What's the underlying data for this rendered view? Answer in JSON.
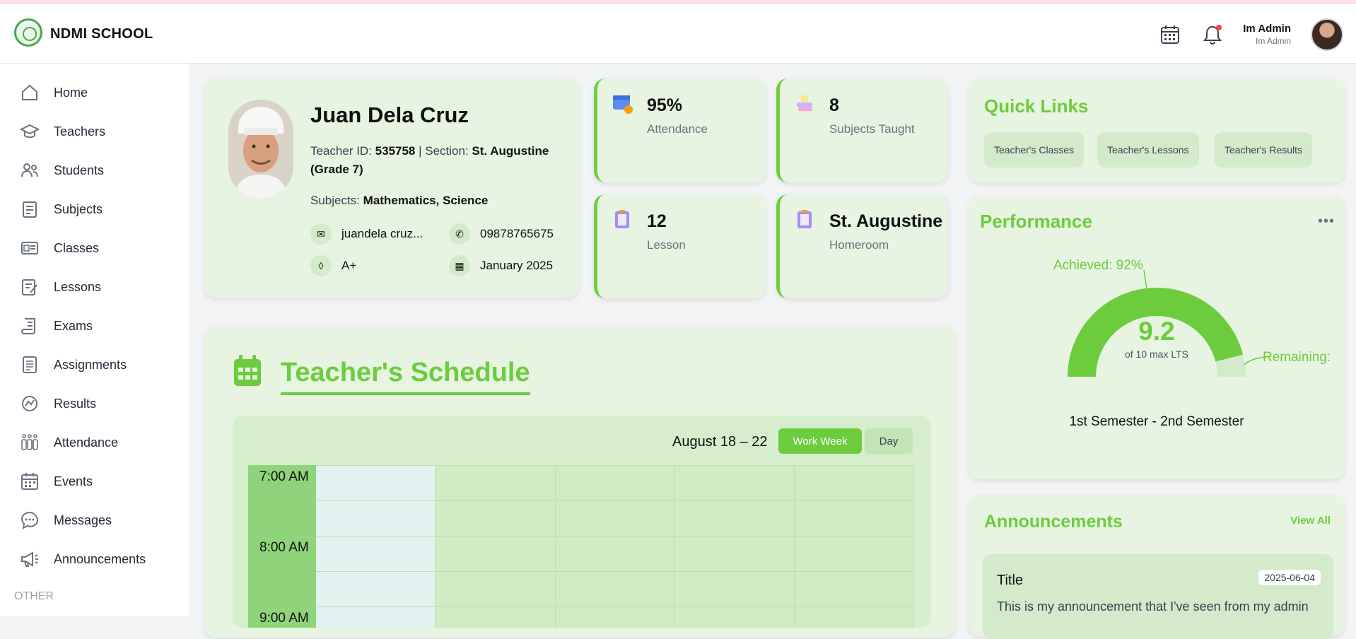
{
  "header": {
    "brand": "NDMI SCHOOL",
    "user_name": "Im Admin",
    "user_role": "Im Admin"
  },
  "sidebar": {
    "items": [
      {
        "label": "Home",
        "icon": "home-icon"
      },
      {
        "label": "Teachers",
        "icon": "graduation-cap-icon"
      },
      {
        "label": "Students",
        "icon": "users-icon"
      },
      {
        "label": "Subjects",
        "icon": "clipboard-icon"
      },
      {
        "label": "Classes",
        "icon": "id-card-icon"
      },
      {
        "label": "Lessons",
        "icon": "edit-icon"
      },
      {
        "label": "Exams",
        "icon": "scroll-icon"
      },
      {
        "label": "Assignments",
        "icon": "document-icon"
      },
      {
        "label": "Results",
        "icon": "chart-circle-icon"
      },
      {
        "label": "Attendance",
        "icon": "people-grid-icon"
      },
      {
        "label": "Events",
        "icon": "calendar-icon"
      },
      {
        "label": "Messages",
        "icon": "chat-bubble-icon"
      },
      {
        "label": "Announcements",
        "icon": "megaphone-icon"
      }
    ],
    "other_label": "OTHER"
  },
  "profile": {
    "name": "Juan Dela Cruz",
    "id_label": "Teacher ID: ",
    "id_value": "535758",
    "section_label": " | Section: ",
    "section_value": "St. Augustine",
    "grade": "(Grade 7)",
    "subjects_label": "Subjects: ",
    "subjects_value": "Mathematics, Science",
    "email": "juandela cruz...",
    "phone": "09878765675",
    "blood_type": "A+",
    "date": "January 2025"
  },
  "stats": [
    {
      "value": "95%",
      "label": "Attendance",
      "icon": "calendar-badge-icon"
    },
    {
      "value": "8",
      "label": "Subjects Taught",
      "icon": "books-icon"
    },
    {
      "value": "12",
      "label": "Lesson",
      "icon": "clipboard-list-icon"
    },
    {
      "value": "St. Augustine",
      "label": "Homeroom",
      "icon": "clipboard-list-icon"
    }
  ],
  "quick_links": {
    "title": "Quick Links",
    "links": [
      "Teacher's Classes",
      "Teacher's Lessons",
      "Teacher's Results"
    ]
  },
  "performance": {
    "title": "Performance",
    "menu": "•••",
    "score": "9.2",
    "max_label": "of 10 max LTS",
    "achieved_label": "Achieved: 92%",
    "remaining_label": "Remaining:",
    "period": "1st Semester - 2nd Semester",
    "achieved_fraction": 0.92,
    "achieved_color": "#6dcc3e"
  },
  "schedule": {
    "title": "Teacher's Schedule",
    "range": "August 18 – 22",
    "views": [
      "Work Week",
      "Day"
    ],
    "active_view": "Work Week",
    "times": [
      "7:00 AM",
      "8:00 AM",
      "9:00 AM"
    ]
  },
  "announcements": {
    "title": "Announcements",
    "view_all": "View All",
    "items": [
      {
        "title": "Title",
        "date": "2025-06-04",
        "description": "This is my announcement that I've seen from my admin"
      }
    ]
  },
  "colors": {
    "accent": "#6dcc3e",
    "card_bg": "#e6f4e1"
  }
}
